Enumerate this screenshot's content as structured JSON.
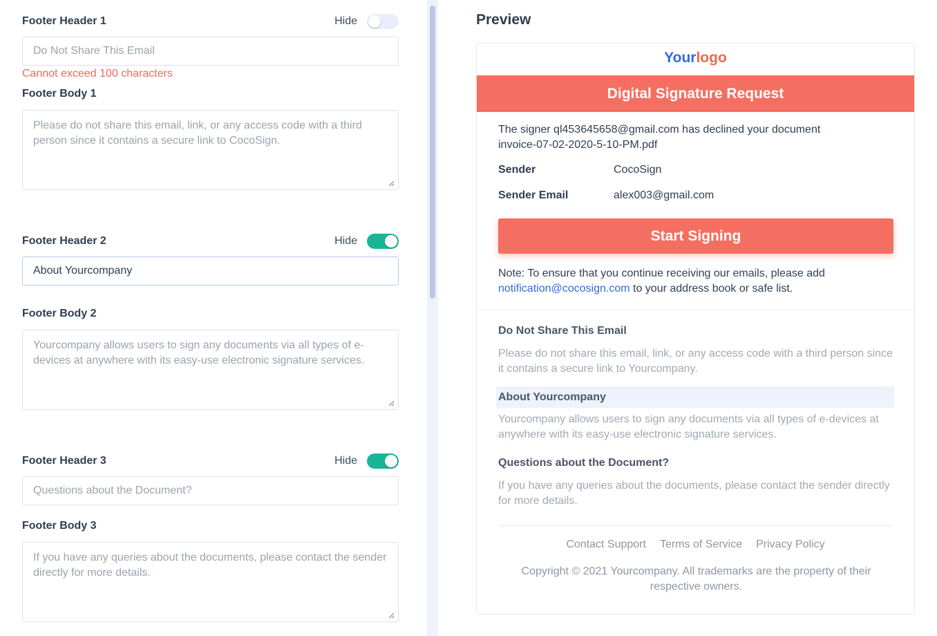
{
  "editor": {
    "hide_label": "Hide",
    "footer1": {
      "header_label": "Footer Header 1",
      "header_toggle_on": false,
      "header_placeholder": "Do Not Share This Email",
      "error": "Cannot exceed 100 characters",
      "body_label": "Footer Body 1",
      "body_placeholder": "Please do not share this email, link, or any access code with a third person since it contains a secure link to CocoSign."
    },
    "footer2": {
      "header_label": "Footer Header 2",
      "header_toggle_on": true,
      "header_value": "About Yourcompany",
      "body_label": "Footer Body 2",
      "body_placeholder": "Yourcompany allows users to sign any documents via all types of e-devices at anywhere with its easy-use electronic signature services."
    },
    "footer3": {
      "header_label": "Footer Header 3",
      "header_toggle_on": true,
      "header_placeholder": "Questions about the Document?",
      "body_label": "Footer Body 3",
      "body_placeholder": "If you have any queries about the documents, please contact the sender directly for more details."
    }
  },
  "preview": {
    "title": "Preview",
    "logo_part1": "Your",
    "logo_part2": "logo",
    "banner": "Digital Signature Request",
    "message_line1": "The signer ql453645658@gmail.com has declined your document",
    "message_line2": "invoice-07-02-2020-5-10-PM.pdf",
    "sender_label": "Sender",
    "sender_value": "CocoSign",
    "sender_email_label": "Sender Email",
    "sender_email_value": "alex003@gmail.com",
    "cta": "Start Signing",
    "note_prefix": "Note: To ensure that you continue receiving our emails, please add",
    "note_link": "notification@cocosign.com",
    "note_suffix": " to your address book or safe list.",
    "footer_sections": [
      {
        "header": "Do Not Share This Email",
        "body": "Please do not share this email, link, or any access code with a third person since it contains a secure link to Yourcompany."
      },
      {
        "header": "About Yourcompany",
        "body": "Yourcompany allows users to sign any documents via all types of e-devices at anywhere with its easy-use electronic signature services."
      },
      {
        "header": "Questions about the Document?",
        "body": "If you have any queries about the documents, please contact the sender directly for more details."
      }
    ],
    "links": [
      "Contact Support",
      "Terms of Service",
      "Privacy Policy"
    ],
    "copyright": "Copyright © 2021 Yourcompany. All trademarks are the property of their respective owners."
  },
  "colors": {
    "accent_coral": "#f46f61",
    "toggle_on": "#18b598",
    "logo_blue": "#2f6bde",
    "error_red": "#f0685a"
  }
}
